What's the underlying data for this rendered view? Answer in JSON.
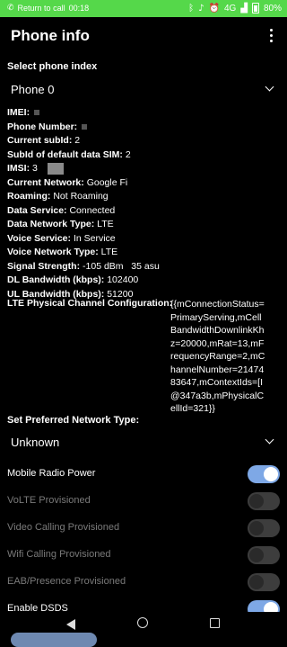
{
  "status_bar": {
    "call_text": "Return to call",
    "time": "00:18",
    "network": "4G",
    "battery": "80%"
  },
  "header": {
    "title": "Phone info"
  },
  "phone_index": {
    "label": "Select phone index",
    "value": "Phone 0"
  },
  "info_rows": [
    {
      "key": "IMEI:",
      "value": ""
    },
    {
      "key": "Phone Number:",
      "value": ""
    },
    {
      "key": "Current subId:",
      "value": "2"
    },
    {
      "key": "SubId of default data SIM:",
      "value": "2"
    },
    {
      "key": "IMSI:",
      "value": "3"
    },
    {
      "key": "Current Network:",
      "value": "Google Fi"
    },
    {
      "key": "Roaming:",
      "value": "Not Roaming"
    },
    {
      "key": "Data Service:",
      "value": "Connected"
    },
    {
      "key": "Data Network Type:",
      "value": "LTE"
    },
    {
      "key": "Voice Service:",
      "value": "In Service"
    },
    {
      "key": "Voice Network Type:",
      "value": "LTE"
    },
    {
      "key": "Signal Strength:",
      "value": "-105 dBm   35 asu"
    },
    {
      "key": "DL Bandwidth (kbps):",
      "value": "102400"
    },
    {
      "key": "UL Bandwidth (kbps):",
      "value": "51200"
    }
  ],
  "lte_config": {
    "key": "LTE Physical Channel Configuration:",
    "value": "{{mConnectionStatus=PrimaryServing,mCellBandwidthDownlinkKhz=20000,mRat=13,mFrequencyRange=2,mChannelNumber=2147483647,mContextIds=[I@347a3b,mPhysicalCellId=321}}"
  },
  "network_type": {
    "label": "Set Preferred Network Type:",
    "value": "Unknown"
  },
  "switches": [
    {
      "label": "Mobile Radio Power",
      "on": true,
      "enabled": true
    },
    {
      "label": "VoLTE Provisioned",
      "on": false,
      "enabled": false
    },
    {
      "label": "Video Calling Provisioned",
      "on": false,
      "enabled": false
    },
    {
      "label": "Wifi Calling Provisioned",
      "on": false,
      "enabled": false
    },
    {
      "label": "EAB/Presence Provisioned",
      "on": false,
      "enabled": false
    },
    {
      "label": "Enable DSDS",
      "on": true,
      "enabled": true
    }
  ],
  "colors": {
    "status_bar": "#55d84a",
    "toggle_on": "#7ea8e6"
  }
}
